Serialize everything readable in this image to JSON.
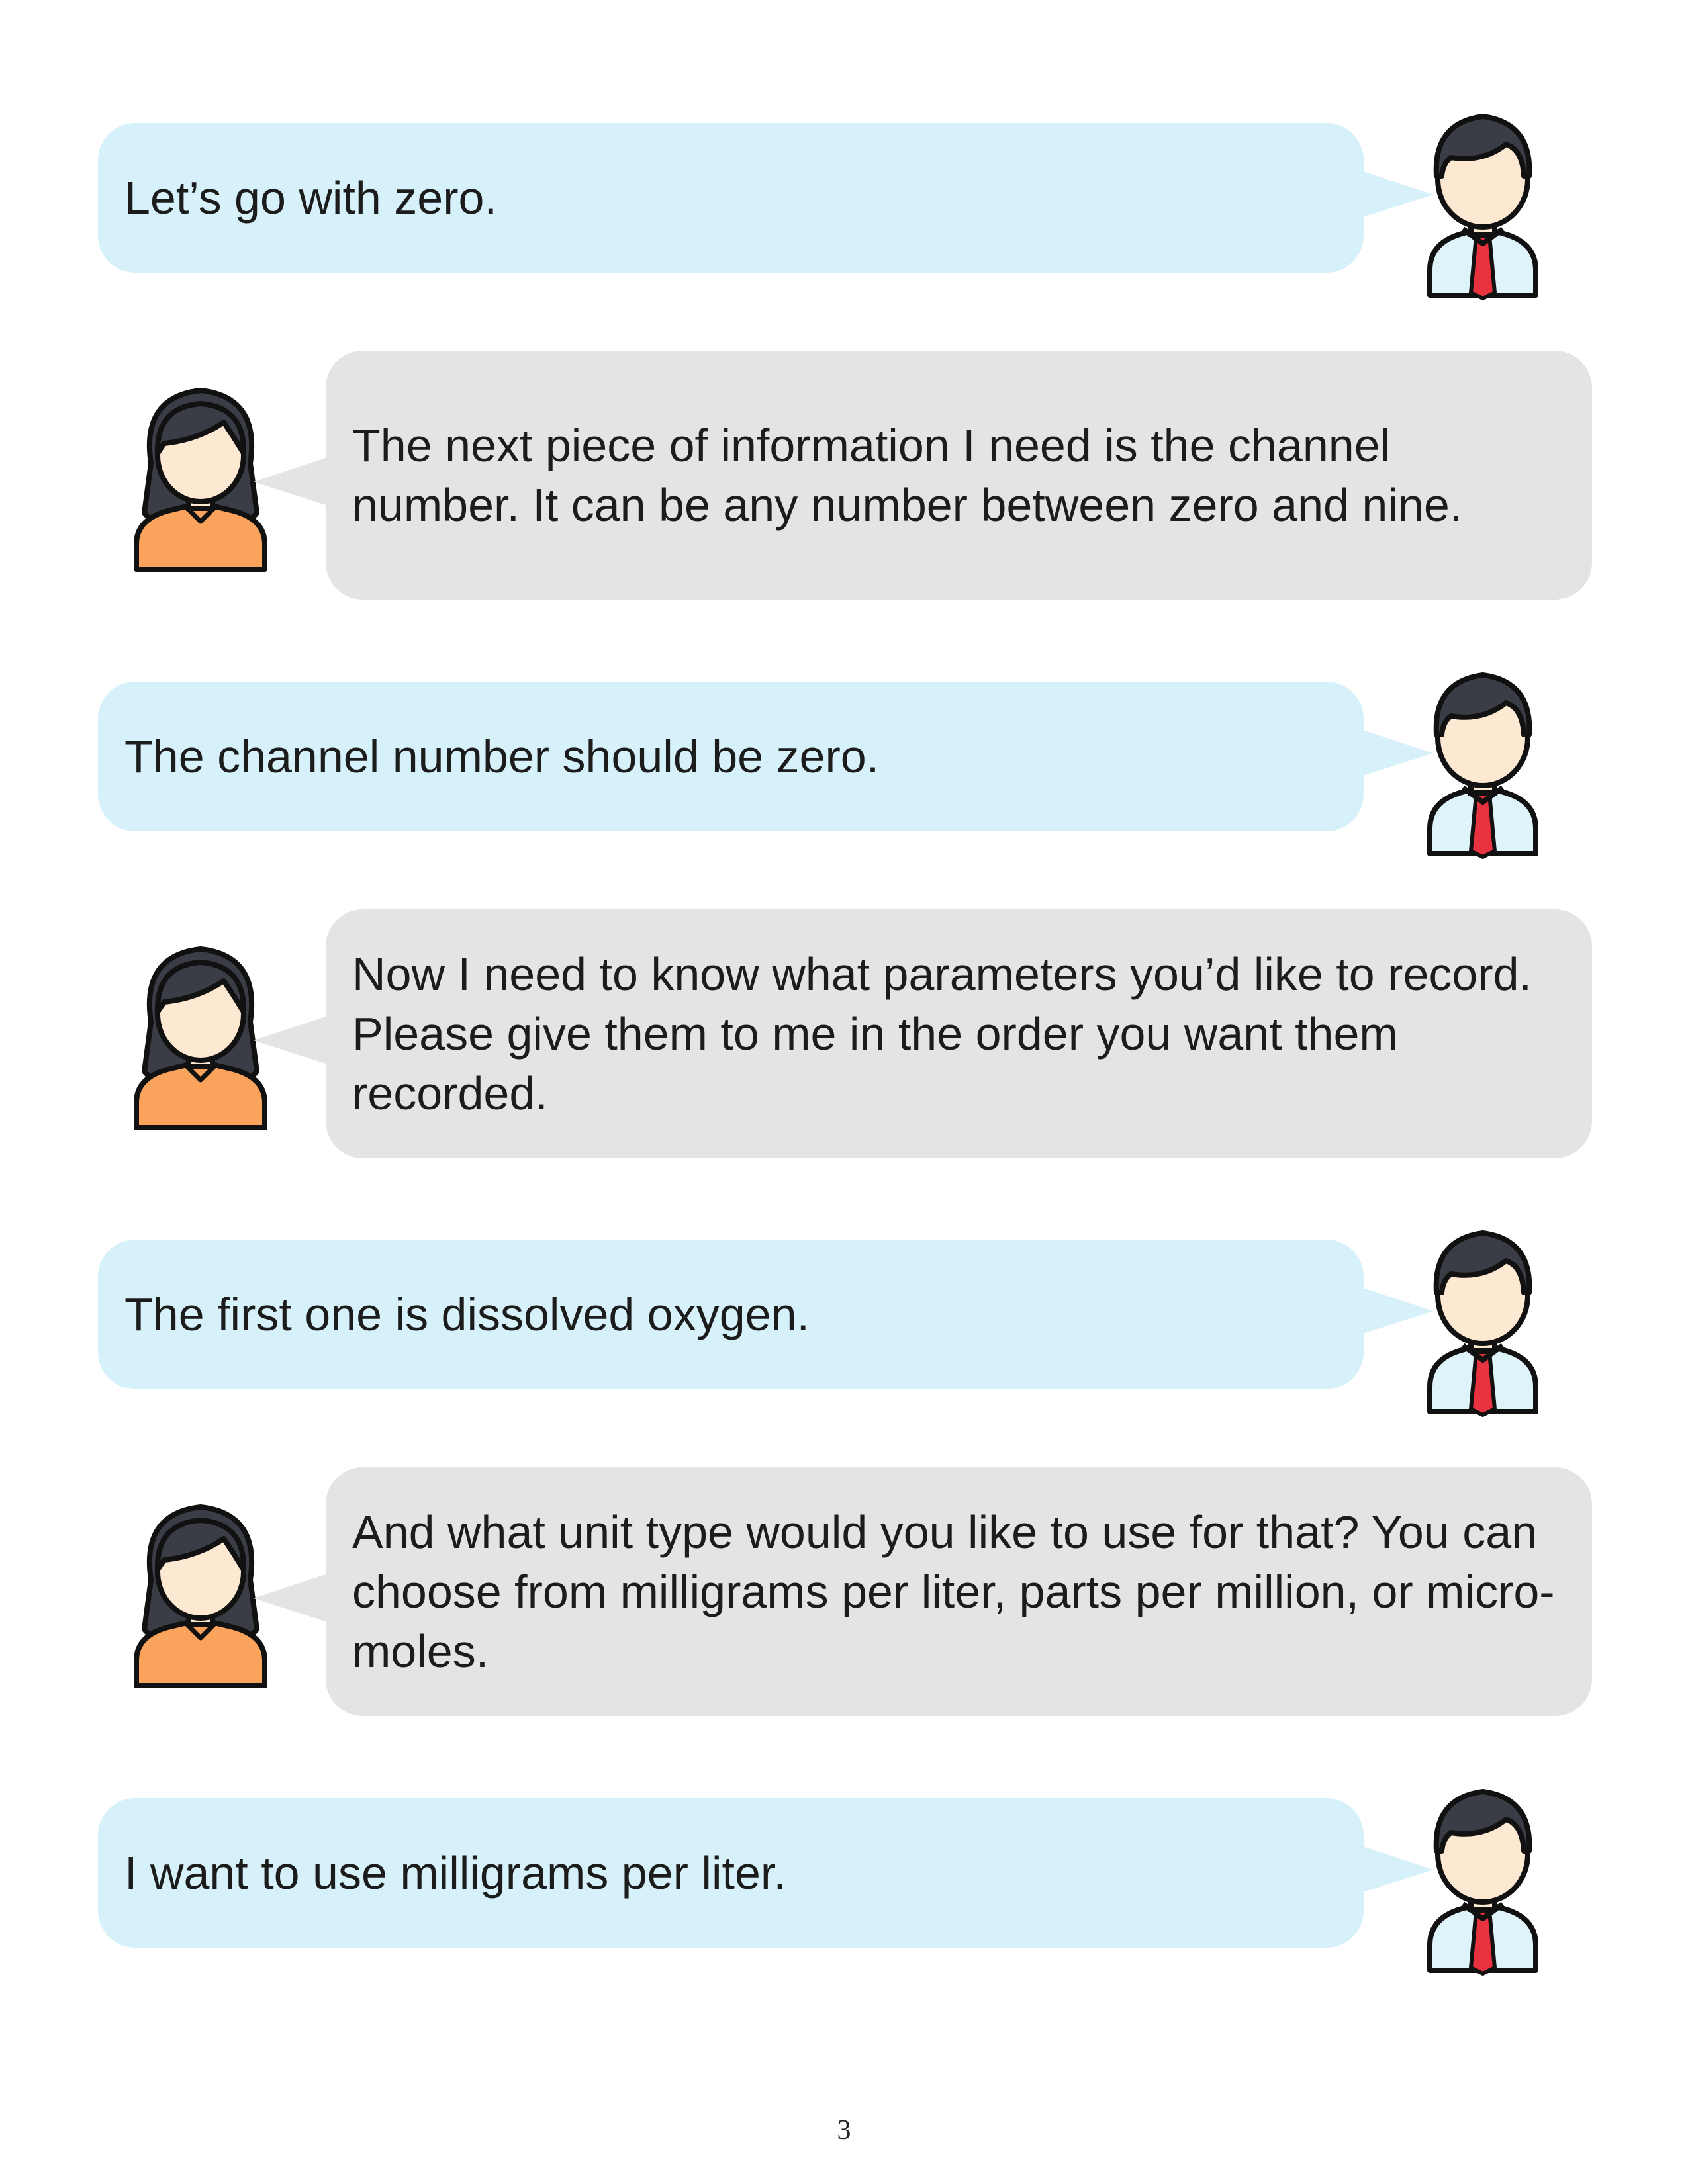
{
  "messages": [
    {
      "speaker": "man",
      "text": "Let’s go with zero."
    },
    {
      "speaker": "woman",
      "text": "The next piece of information I need is the channel number. It can be any number between zero and nine."
    },
    {
      "speaker": "man",
      "text": "The channel number should be zero."
    },
    {
      "speaker": "woman",
      "text": "Now I need to know what parameters you’d like to record. Please give them to me in the order you want them recorded."
    },
    {
      "speaker": "man",
      "text": "The first one is dissolved oxygen."
    },
    {
      "speaker": "woman",
      "text": "And what unit type would you like to use for that? You can choose from milligrams per liter, parts per million, or micro-moles."
    },
    {
      "speaker": "man",
      "text": "I want to use milligrams per liter."
    }
  ],
  "icons": {
    "man": "man-avatar-icon",
    "woman": "woman-avatar-icon"
  },
  "colors": {
    "man_bubble": "#d6f1f9",
    "woman_bubble": "#e4e4e4",
    "man_tie": "#e8323f",
    "woman_shirt": "#f9a35c",
    "skin": "#fde8d2",
    "hair": "#3a3d45"
  },
  "page_number": "3"
}
